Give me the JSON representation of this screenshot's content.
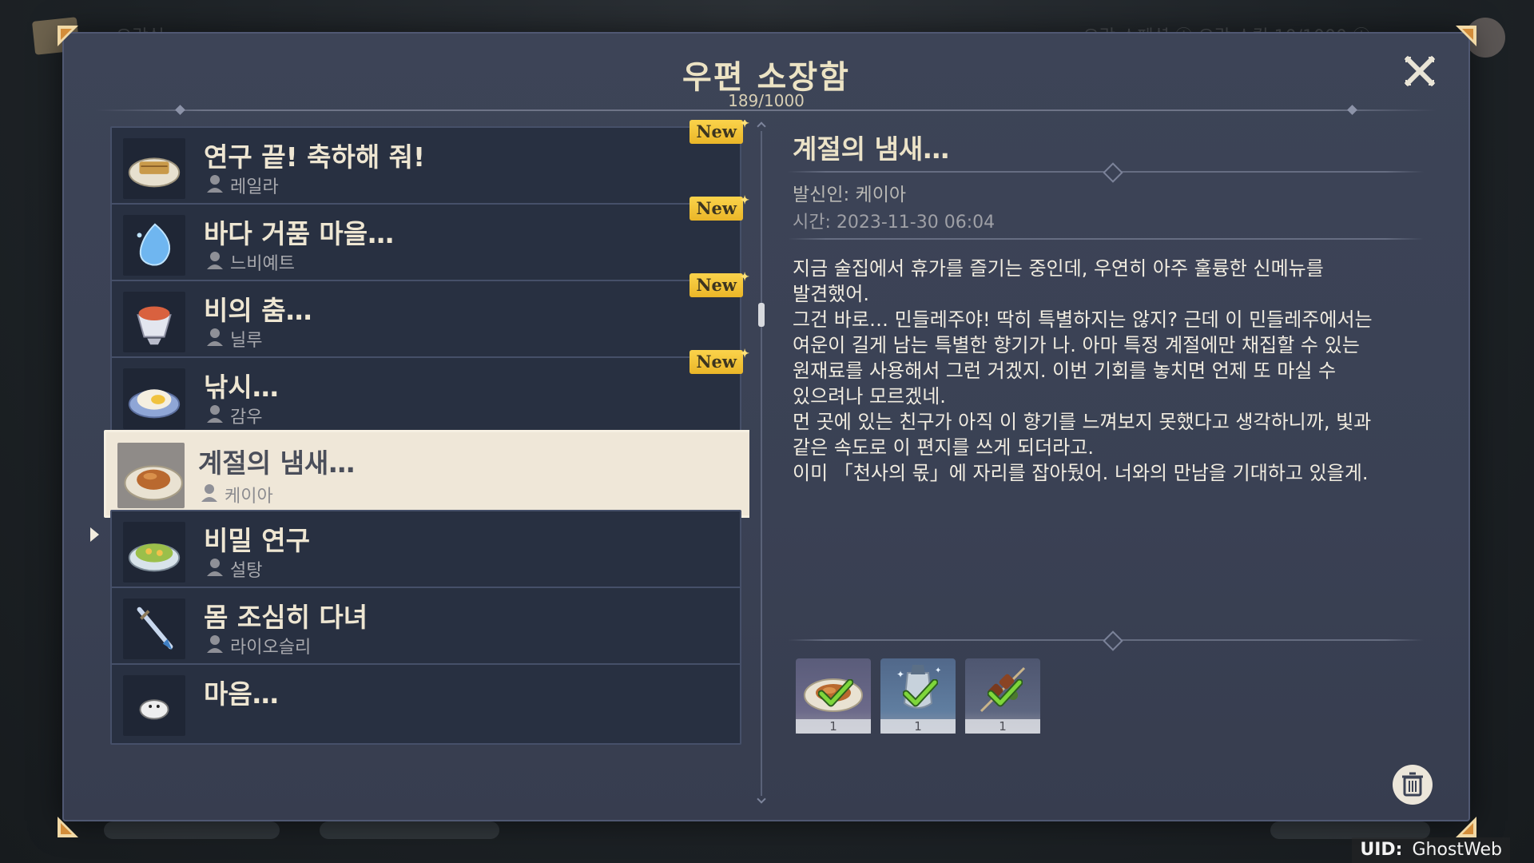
{
  "window": {
    "title": "우편 소장함",
    "counter": "189/1000"
  },
  "mail_list": [
    {
      "title": "연구 끝! 축하해 줘!",
      "sender": "레일라",
      "new": true,
      "icon": "food-dish-icon"
    },
    {
      "title": "바다 거품 마을…",
      "sender": "느비예트",
      "new": true,
      "icon": "water-drop-icon"
    },
    {
      "title": "비의 춤…",
      "sender": "닐루",
      "new": true,
      "icon": "dessert-cup-icon"
    },
    {
      "title": "낚시…",
      "sender": "감우",
      "new": true,
      "icon": "rice-dish-icon"
    },
    {
      "title": "계절의 냄새…",
      "sender": "케이아",
      "new": false,
      "selected": true,
      "icon": "roast-dish-icon"
    },
    {
      "title": "비밀 연구",
      "sender": "설탕",
      "new": false,
      "icon": "salad-bowl-icon"
    },
    {
      "title": "몸 조심히 다녀",
      "sender": "라이오슬리",
      "new": false,
      "icon": "dagger-icon"
    },
    {
      "title": "마음…",
      "sender": "",
      "new": false,
      "icon": "crab-icon"
    }
  ],
  "new_badge_label": "New",
  "detail": {
    "title": "계절의 냄새…",
    "sender": "발신인: 케이아",
    "time": "시간: 2023-11-30 06:04",
    "body": "지금 술집에서 휴가를 즐기는 중인데, 우연히 아주 훌륭한 신메뉴를\n발견했어.\n그건 바로… 민들레주야! 딱히 특별하지는 않지? 근데 이 민들레주에서는\n여운이 길게 남는 특별한 향기가 나. 아마 특정 계절에만 채집할 수 있는\n원재료를 사용해서 그런 거겠지. 이번 기회를 놓치면 언제 또 마실 수\n있으려나 모르겠네.\n먼 곳에 있는 친구가 아직 이 향기를 느껴보지 못했다고 생각하니까, 빛과\n같은 속도로 이 편지를 쓰게 되더라고.\n이미 「천사의 몫」에 자리를 잡아뒀어. 너와의 만남을 기대하고 있을게."
  },
  "attachments": [
    {
      "icon": "roast-dish-icon",
      "qty": "1",
      "claimed": true
    },
    {
      "icon": "wine-bottle-icon",
      "qty": "1",
      "claimed": true
    },
    {
      "icon": "meat-skewer-icon",
      "qty": "1",
      "claimed": true
    }
  ],
  "uid": {
    "label": "UID:",
    "value": "GhostWeb"
  },
  "background_hud": {
    "left": "오락실",
    "right": "오락 스페셜 ⓘ   오락 스킬 10/1000 ⓘ"
  },
  "colors": {
    "panel": "#3b4255",
    "item": "#283041",
    "selected_item": "#efe7d8",
    "new_badge": "#f5c63a",
    "title_text": "#ece3c4"
  }
}
